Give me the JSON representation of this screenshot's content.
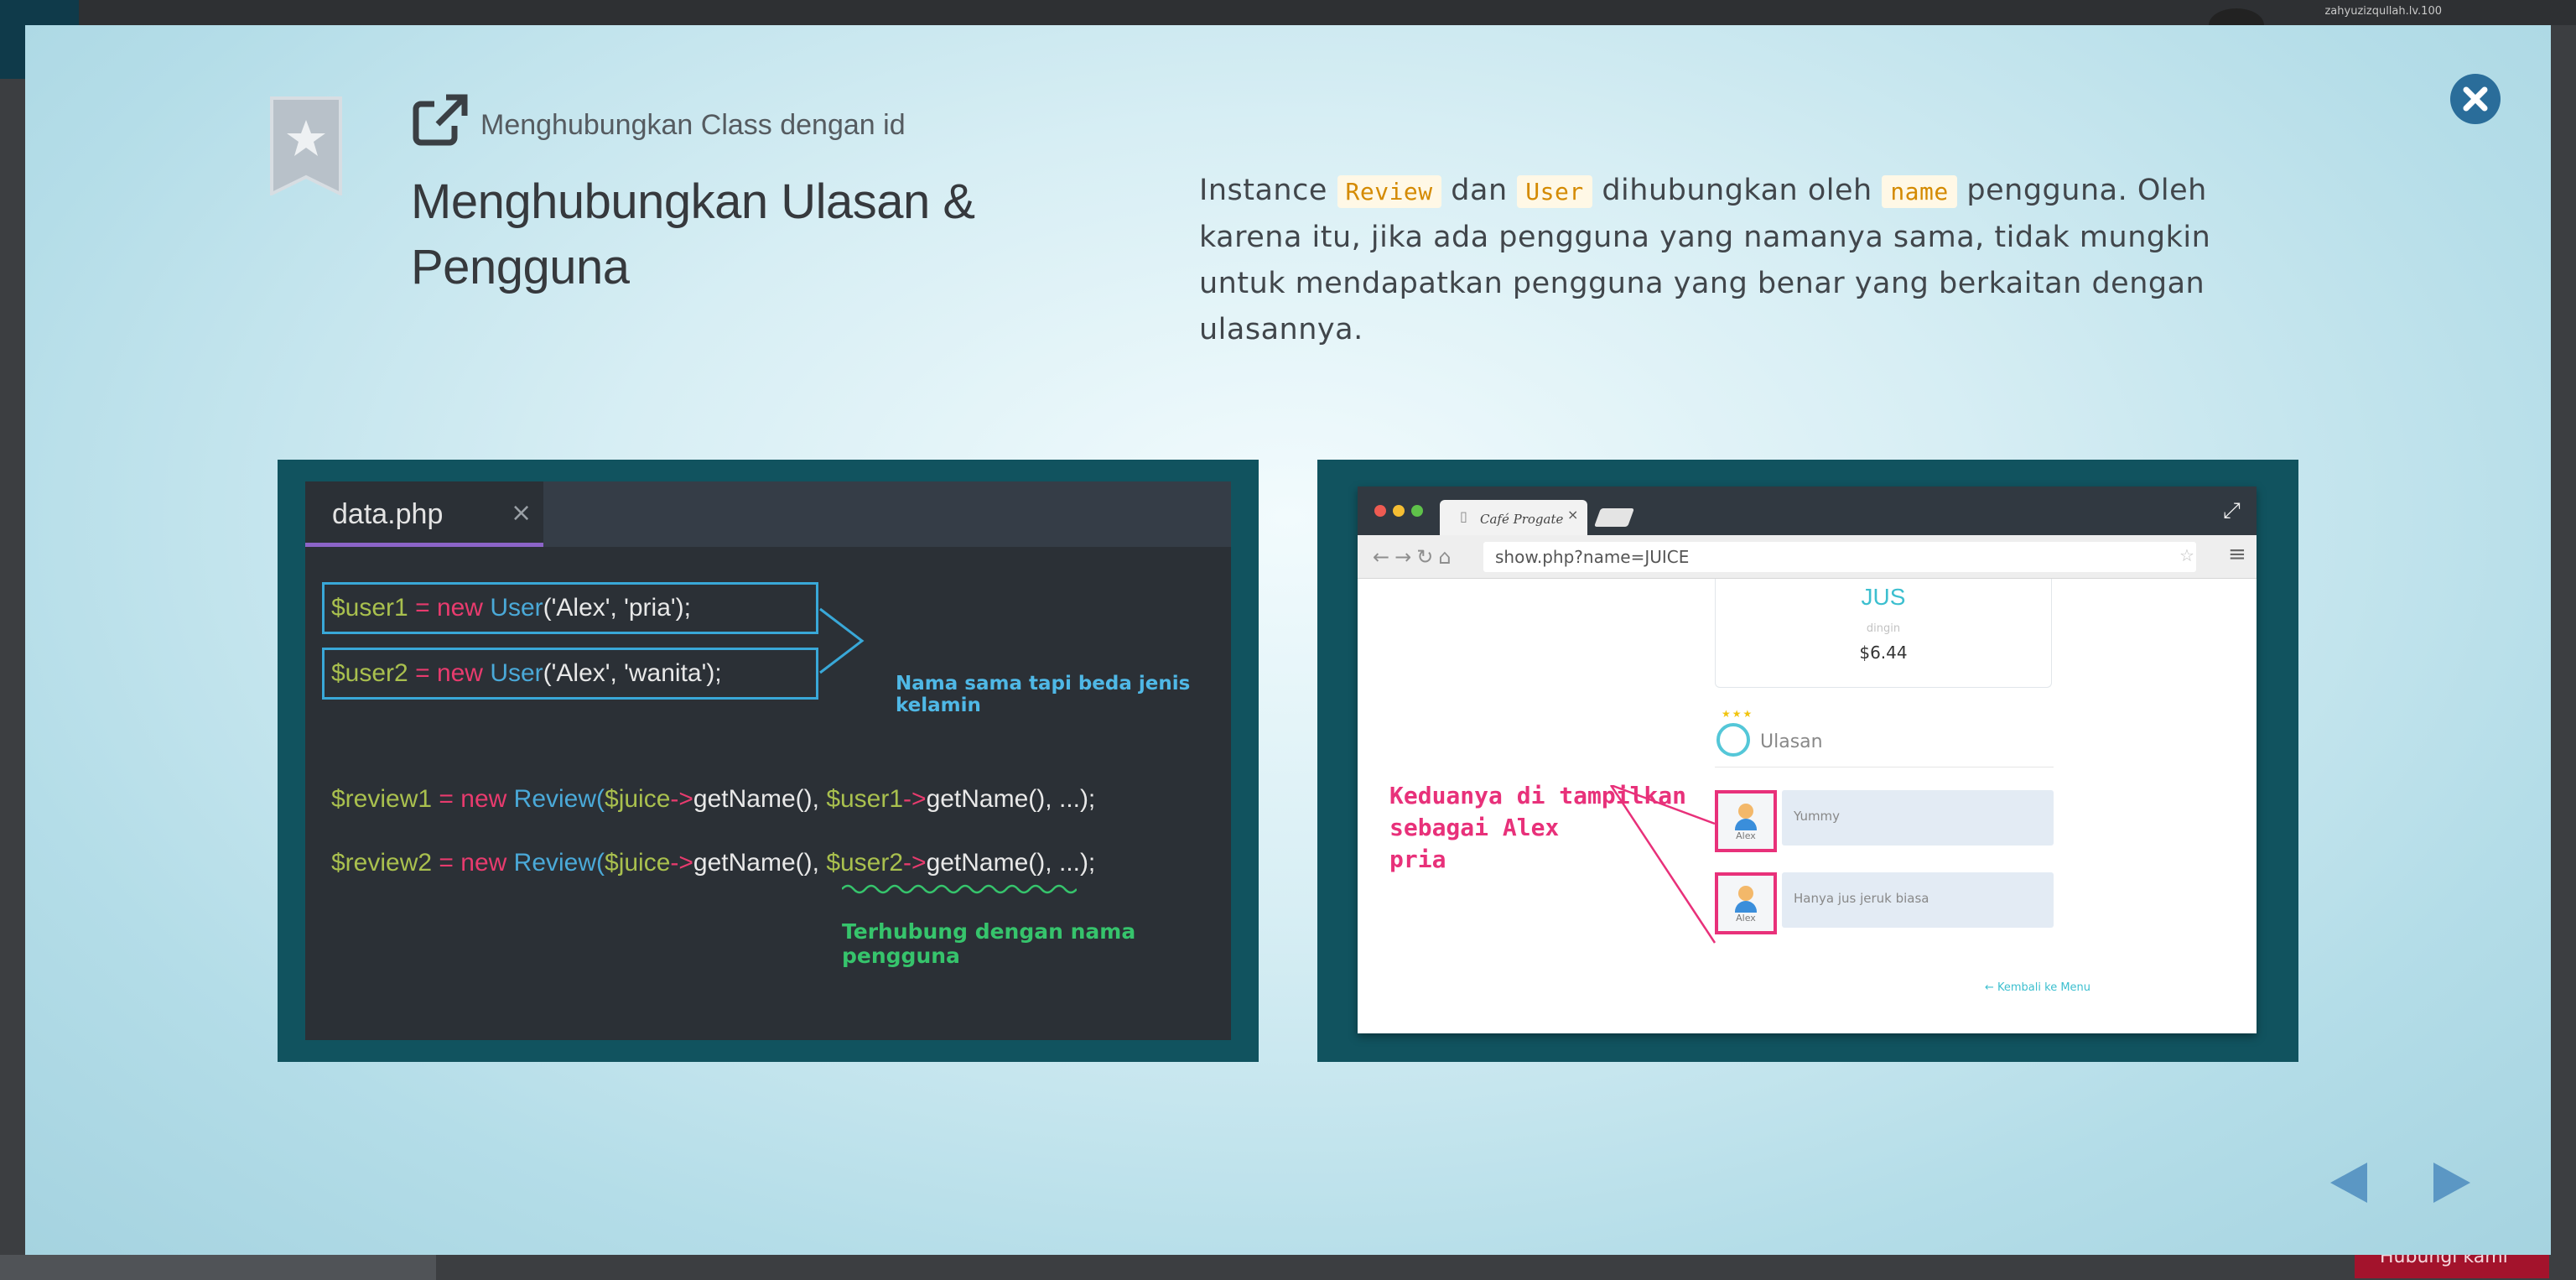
{
  "background": {
    "user_text": "zahyuzizqullah.lv.100",
    "help_button": "Hubungi kami"
  },
  "header": {
    "subtitle": "Menghubungkan Class dengan id",
    "title": "Menghubungkan Ulasan & Pengguna"
  },
  "description": {
    "p1": "Instance ",
    "code1": "Review",
    "p2": " dan ",
    "code2": "User",
    "p3": " dihubungkan oleh ",
    "code3": "name",
    "p4": " pengguna. Oleh karena itu, jika ada pengguna yang namanya sama, tidak mungkin untuk mendapatkan pengguna yang benar yang berkaitan dengan ulasannya."
  },
  "editor": {
    "tab_name": "data.php",
    "tab_close": "×",
    "line1": {
      "var": "$user1",
      "eq": " = ",
      "kw": "new",
      "cls": " User",
      "args": "('Alex', 'pria');"
    },
    "line2": {
      "var": "$user2",
      "eq": " = ",
      "kw": "new",
      "cls": " User",
      "args": "('Alex', 'wanita');"
    },
    "line3": {
      "var": "$review1",
      "eq": " = ",
      "kw": "new",
      "cls": " Review",
      "open": "(",
      "a1": "$juice",
      "arrow1": "->",
      "m1": "getName(), ",
      "a2": "$user1",
      "arrow2": "->",
      "m2": "getName(), ...);"
    },
    "line4": {
      "var": "$review2",
      "eq": " = ",
      "kw": "new",
      "cls": " Review",
      "open": "(",
      "a1": "$juice",
      "arrow1": "->",
      "m1": "getName(), ",
      "a2": "$user2",
      "arrow2": "->",
      "m2": "getName(), ...);"
    },
    "note_blue": "Nama sama tapi beda jenis kelamin",
    "note_green": "Terhubung dengan nama pengguna"
  },
  "browser": {
    "tab_label": "Café Progate",
    "tab_close": "×",
    "url": "show.php?name=JUICE",
    "product_name": "JUS",
    "product_sub": "dingin",
    "product_price": "$6.44",
    "reviews_title": "Ulasan",
    "reviews": [
      {
        "user": "Alex",
        "text": "Yummy"
      },
      {
        "user": "Alex",
        "text": "Hanya jus jeruk biasa"
      }
    ],
    "back_link": "← Kembali ke Menu",
    "note_pink": [
      "Keduanya di tampilkan",
      "sebagai Alex",
      "pria"
    ]
  },
  "colors": {
    "accent": "#11535f",
    "close_button": "#2a6d9a",
    "nav_arrow": "#5b97c4",
    "highlight_pink": "#e8317a"
  }
}
